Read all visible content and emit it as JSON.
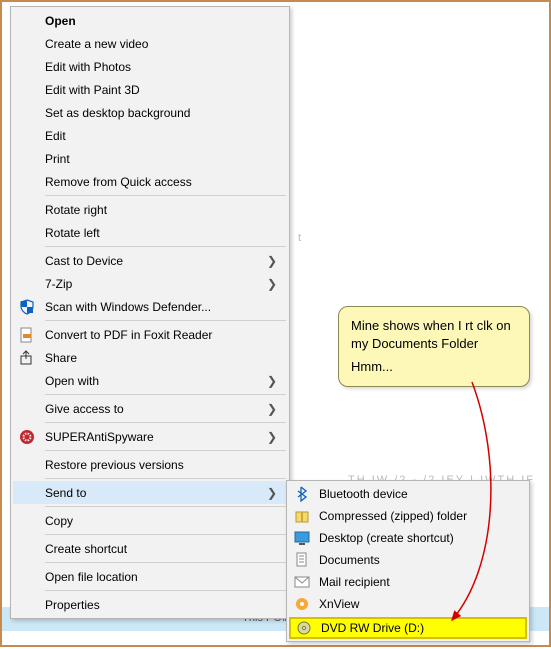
{
  "background": {
    "pathText": "This PC\\Pictu"
  },
  "contextMenu": {
    "groups": [
      [
        {
          "label": "Open",
          "bold": true,
          "submenu": false,
          "icon": null
        },
        {
          "label": "Create a new video",
          "bold": false,
          "submenu": false,
          "icon": null
        },
        {
          "label": "Edit with Photos",
          "bold": false,
          "submenu": false,
          "icon": null
        },
        {
          "label": "Edit with Paint 3D",
          "bold": false,
          "submenu": false,
          "icon": null
        },
        {
          "label": "Set as desktop background",
          "bold": false,
          "submenu": false,
          "icon": null
        },
        {
          "label": "Edit",
          "bold": false,
          "submenu": false,
          "icon": null
        },
        {
          "label": "Print",
          "bold": false,
          "submenu": false,
          "icon": null
        },
        {
          "label": "Remove from Quick access",
          "bold": false,
          "submenu": false,
          "icon": null
        }
      ],
      [
        {
          "label": "Rotate right",
          "bold": false,
          "submenu": false,
          "icon": null
        },
        {
          "label": "Rotate left",
          "bold": false,
          "submenu": false,
          "icon": null
        }
      ],
      [
        {
          "label": "Cast to Device",
          "bold": false,
          "submenu": true,
          "icon": null
        },
        {
          "label": "7-Zip",
          "bold": false,
          "submenu": true,
          "icon": null
        },
        {
          "label": "Scan with Windows Defender...",
          "bold": false,
          "submenu": false,
          "icon": "defender"
        }
      ],
      [
        {
          "label": "Convert to PDF in Foxit Reader",
          "bold": false,
          "submenu": false,
          "icon": "pdf"
        },
        {
          "label": "Share",
          "bold": false,
          "submenu": false,
          "icon": "share"
        },
        {
          "label": "Open with",
          "bold": false,
          "submenu": true,
          "icon": null
        }
      ],
      [
        {
          "label": "Give access to",
          "bold": false,
          "submenu": true,
          "icon": null
        }
      ],
      [
        {
          "label": "SUPERAntiSpyware",
          "bold": false,
          "submenu": true,
          "icon": "sas"
        }
      ],
      [
        {
          "label": "Restore previous versions",
          "bold": false,
          "submenu": false,
          "icon": null
        }
      ],
      [
        {
          "label": "Send to",
          "bold": false,
          "submenu": true,
          "icon": null,
          "hovered": true
        }
      ],
      [
        {
          "label": "Copy",
          "bold": false,
          "submenu": false,
          "icon": null
        }
      ],
      [
        {
          "label": "Create shortcut",
          "bold": false,
          "submenu": false,
          "icon": null
        }
      ],
      [
        {
          "label": "Open file location",
          "bold": false,
          "submenu": false,
          "icon": null
        }
      ],
      [
        {
          "label": "Properties",
          "bold": false,
          "submenu": false,
          "icon": null
        }
      ]
    ]
  },
  "subMenu": {
    "items": [
      {
        "label": "Bluetooth device",
        "icon": "bluetooth"
      },
      {
        "label": "Compressed (zipped) folder",
        "icon": "zip"
      },
      {
        "label": "Desktop (create shortcut)",
        "icon": "desktop"
      },
      {
        "label": "Documents",
        "icon": "documents"
      },
      {
        "label": "Mail recipient",
        "icon": "mail"
      },
      {
        "label": "XnView",
        "icon": "xnview"
      }
    ],
    "highlighted": {
      "label": "DVD RW Drive (D:)",
      "icon": "dvd"
    }
  },
  "callout": {
    "line1": "Mine shows when I rt clk on my Documents Folder",
    "line2": "Hmm..."
  }
}
